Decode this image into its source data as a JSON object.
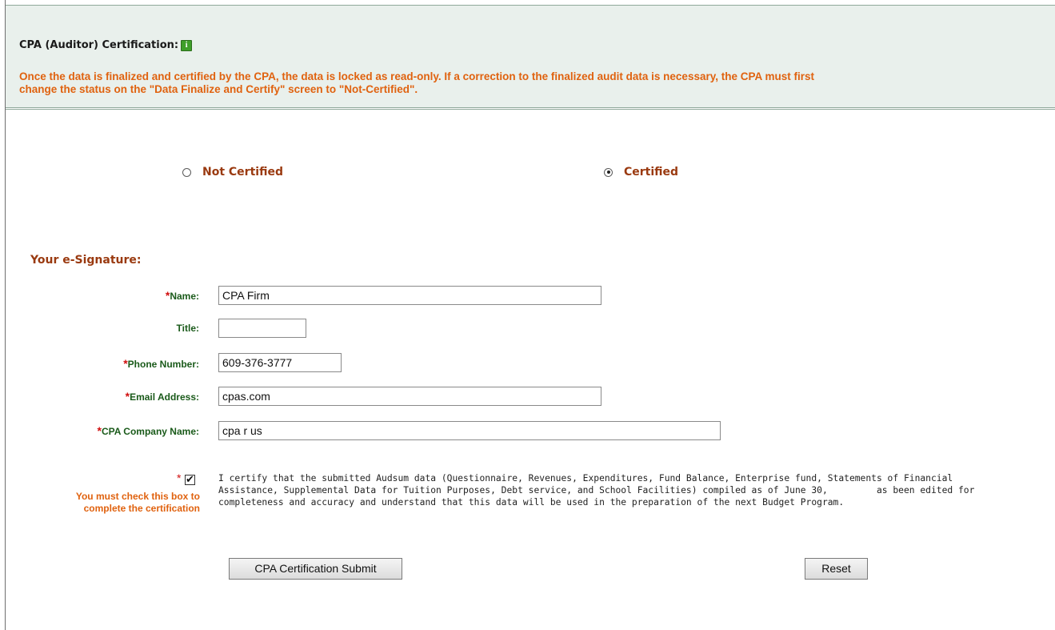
{
  "header": {
    "title": "CPA (Auditor) Certification:",
    "info_icon": "info-icon",
    "notice_line1": "Once the data is finalized and certified by the CPA, the data is locked as read-only. If a correction to the finalized audit data is necessary, the CPA must first",
    "notice_line2": "change the status on the \"Data Finalize and Certify\" screen to \"Not-Certified\"."
  },
  "status": {
    "options": [
      {
        "label": "Not Certified",
        "selected": false
      },
      {
        "label": "Certified",
        "selected": true
      }
    ]
  },
  "signature": {
    "heading": "Your e-Signature:",
    "required_marker": "*",
    "fields": {
      "name": {
        "label": "Name:",
        "value": "CPA Firm",
        "required": true
      },
      "title": {
        "label": "Title:",
        "value": "",
        "required": false
      },
      "phone": {
        "label": "Phone Number:",
        "value": "609-376-3777",
        "required": true
      },
      "email": {
        "label": "Email Address:",
        "value": "cpas.com",
        "required": true
      },
      "company": {
        "label": "CPA Company Name:",
        "value": "cpa r us",
        "required": true
      }
    }
  },
  "certification": {
    "required_marker": "*",
    "checked": true,
    "check_glyph": "✔",
    "must_check_text": "You must check this box to complete the certification",
    "statement_line1": "I certify that the submitted Audsum data (Questionnaire, Revenues, Expenditures, Fund Balance, Enterprise fund, Statements of Financial",
    "statement_line2": "Assistance, Supplemental Data for Tuition Purposes, Debt service, and School Facilities) compiled as of June 30,         as been edited for",
    "statement_line3": "completeness and accuracy and understand that this data will be used in the preparation of the next Budget Program."
  },
  "actions": {
    "submit_label": "CPA Certification Submit",
    "reset_label": "Reset"
  },
  "colors": {
    "header_bg": "#e9f0ec",
    "notice": "#e0620f",
    "label_green": "#1a5a1a",
    "heading_brown": "#9a3a10",
    "required_red": "#d01010"
  }
}
